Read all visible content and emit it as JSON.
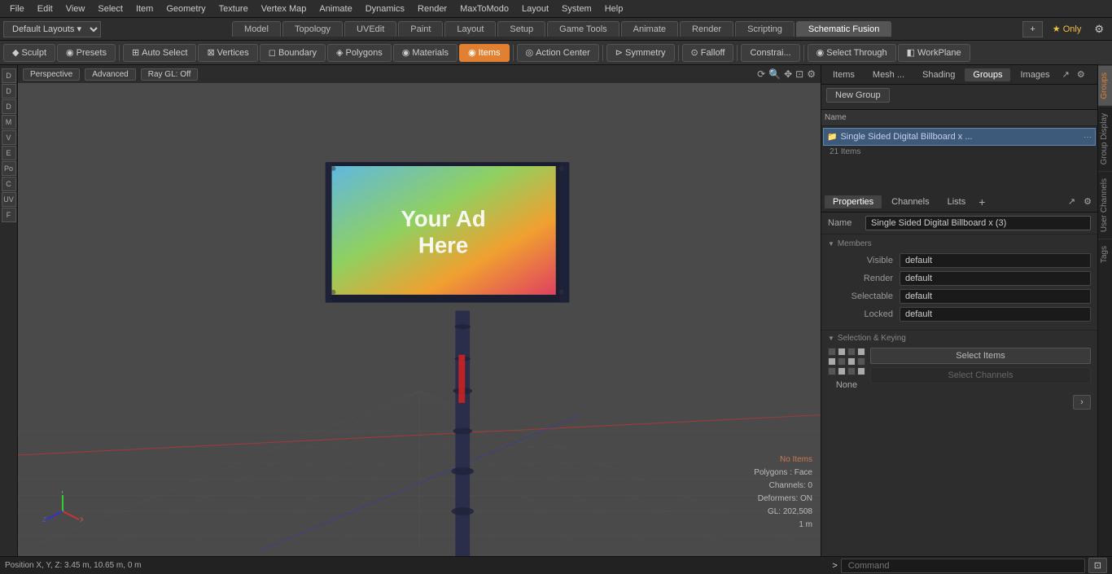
{
  "app": {
    "title": "Modo"
  },
  "menu": {
    "items": [
      "File",
      "Edit",
      "View",
      "Select",
      "Item",
      "Geometry",
      "Texture",
      "Vertex Map",
      "Animate",
      "Dynamics",
      "Render",
      "MaxToModo",
      "Layout",
      "System",
      "Help"
    ]
  },
  "layout_bar": {
    "dropdown": "Default Layouts ▾",
    "tabs": [
      "Model",
      "Topology",
      "UVEdit",
      "Paint",
      "Layout",
      "Setup",
      "Game Tools",
      "Animate",
      "Render",
      "Scripting",
      "Schematic Fusion"
    ],
    "active_tab": "Schematic Fusion",
    "plus_label": "+",
    "star_label": "★ Only",
    "settings_icon": "⚙"
  },
  "tools_bar": {
    "buttons": [
      {
        "label": "Sculpt",
        "icon": "◆",
        "active": false
      },
      {
        "label": "Presets",
        "icon": "◉",
        "active": false
      },
      {
        "label": "Auto Select",
        "icon": "⊞",
        "active": false
      },
      {
        "label": "Vertices",
        "icon": "⊠",
        "active": false
      },
      {
        "label": "Boundary",
        "icon": "◻",
        "active": false
      },
      {
        "label": "Polygons",
        "icon": "◈",
        "active": false
      },
      {
        "label": "Materials",
        "icon": "◉",
        "active": false
      },
      {
        "label": "Items",
        "icon": "◉",
        "active": true
      },
      {
        "label": "Action Center",
        "icon": "◎",
        "active": false
      },
      {
        "label": "Symmetry",
        "icon": "⊳",
        "active": false
      },
      {
        "label": "Falloff",
        "icon": "⊙",
        "active": false
      },
      {
        "label": "Constrai...",
        "icon": "",
        "active": false
      },
      {
        "label": "Select Through",
        "icon": "◉",
        "active": false
      },
      {
        "label": "WorkPlane",
        "icon": "◧",
        "active": false
      }
    ]
  },
  "viewport": {
    "mode_btn": "Perspective",
    "advanced_btn": "Advanced",
    "raygl_btn": "Ray GL: Off",
    "status": {
      "no_items": "No Items",
      "polygons": "Polygons : Face",
      "channels": "Channels: 0",
      "deformers": "Deformers: ON",
      "gl": "GL: 202,508",
      "scale": "1 m"
    },
    "position": "Position X, Y, Z:  3.45 m, 10.65 m, 0 m"
  },
  "right_panel": {
    "top_tabs": [
      "Items",
      "Mesh ...",
      "Shading",
      "Groups",
      "Images"
    ],
    "active_top_tab": "Groups",
    "new_group_btn": "New Group",
    "list_header": "Name",
    "group_item": {
      "name": "Single Sided Digital Billboard x ...",
      "count": "21 Items"
    },
    "prop_tabs": [
      "Properties",
      "Channels",
      "Lists"
    ],
    "active_prop_tab": "Properties",
    "name_label": "Name",
    "name_value": "Single Sided Digital Billboard x (3)",
    "members_header": "Members",
    "props": [
      {
        "label": "Visible",
        "value": "default"
      },
      {
        "label": "Render",
        "value": "default"
      },
      {
        "label": "Selectable",
        "value": "default"
      },
      {
        "label": "Locked",
        "value": "default"
      }
    ],
    "selection_keying_header": "Selection & Keying",
    "keying_none": "None",
    "select_items_btn": "Select Items",
    "select_channels_btn": "Select Channels"
  },
  "right_strip": {
    "tabs": [
      "Groups",
      "Group Display",
      "User Channels",
      "Tags"
    ]
  },
  "bottom_bar": {
    "position": "Position X, Y, Z:  3.45 m, 10.65 m, 0 m",
    "command_placeholder": "Command",
    "prompt_icon": ">"
  }
}
